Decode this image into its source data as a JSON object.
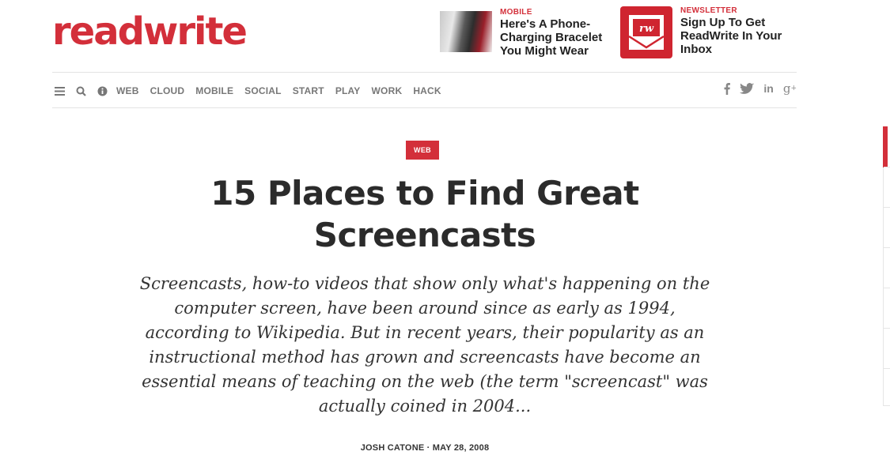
{
  "header": {
    "logo_text": "readwrite",
    "brand_color": "#d32f3a",
    "promos": [
      {
        "category": "MOBILE",
        "title": "Here's A Phone-Charging Bracelet You Might Wear",
        "thumb_icon": "photo-thumbnail"
      },
      {
        "category": "NEWSLETTER",
        "title": "Sign Up To Get ReadWrite In Your Inbox",
        "thumb_icon": "rw-envelope-icon",
        "thumb_label": "rw"
      }
    ]
  },
  "nav": {
    "icons": [
      "menu-icon",
      "search-icon",
      "info-icon"
    ],
    "items": [
      "WEB",
      "CLOUD",
      "MOBILE",
      "SOCIAL",
      "START",
      "PLAY",
      "WORK",
      "HACK"
    ],
    "social": [
      "facebook-icon",
      "twitter-icon",
      "linkedin-icon",
      "google-plus-icon"
    ]
  },
  "article": {
    "category": "WEB",
    "title": "15 Places to Find Great Screencasts",
    "excerpt": "Screencasts, how-to videos that show only what's happening on the computer screen, have been around since as early as 1994, according to Wikipedia. But in recent years, their popularity as an instructional method has grown and screencasts have become an essential means of teaching on the web (the term \"screencast\" was actually coined in 2004...",
    "byline": "JOSH CATONE · MAY 28, 2008"
  }
}
